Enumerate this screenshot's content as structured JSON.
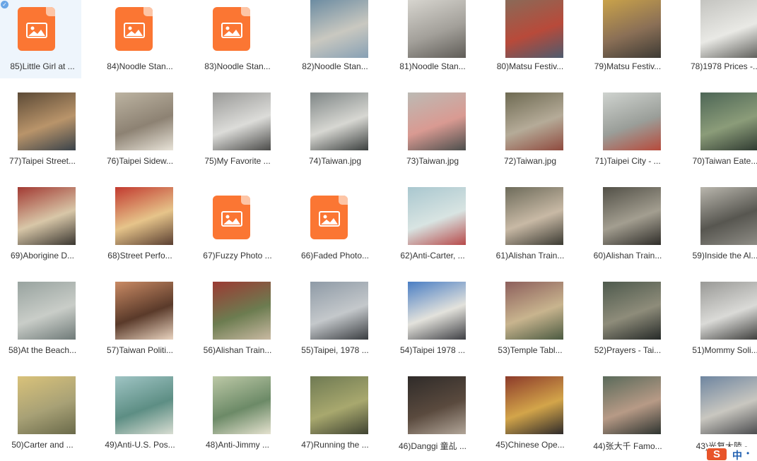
{
  "colors": {
    "selection_bg": "#eef5fc",
    "placeholder_orange": "#fb7633",
    "label_text": "#333333"
  },
  "items": [
    {
      "label": "85)Little Girl at ...",
      "placeholder": true,
      "selected": true,
      "thumb": [
        "#e8e0d6",
        "#c9b7a0",
        "#8a7868"
      ]
    },
    {
      "label": "84)Noodle Stan...",
      "placeholder": true,
      "thumb": [
        "#fff",
        "#fff",
        "#fff"
      ]
    },
    {
      "label": "83)Noodle Stan...",
      "placeholder": true,
      "thumb": [
        "#fff",
        "#fff",
        "#fff"
      ]
    },
    {
      "label": "82)Noodle Stan...",
      "placeholder": false,
      "thumb": [
        "#6c8ca2",
        "#c9c8c0",
        "#87a0b4"
      ]
    },
    {
      "label": "81)Noodle Stan...",
      "placeholder": false,
      "thumb": [
        "#d7d5cf",
        "#a3a09a",
        "#5f5c57"
      ]
    },
    {
      "label": "80)Matsu Festiv...",
      "placeholder": false,
      "thumb": [
        "#8a6a58",
        "#b84a3a",
        "#4d5b6e"
      ]
    },
    {
      "label": "79)Matsu Festiv...",
      "placeholder": false,
      "thumb": [
        "#c9a24a",
        "#8a6f56",
        "#3d3a34"
      ]
    },
    {
      "label": "78)1978 Prices -...",
      "placeholder": false,
      "thumb": [
        "#c4c4c0",
        "#e9e9e5",
        "#5f5f5b"
      ]
    },
    {
      "label": "77)Taipei Street...",
      "placeholder": false,
      "thumb": [
        "#5c4a36",
        "#b9946a",
        "#39424a"
      ]
    },
    {
      "label": "76)Taipei Sidew...",
      "placeholder": false,
      "thumb": [
        "#bcb3a1",
        "#8d8273",
        "#e8e3d8"
      ]
    },
    {
      "label": "75)My Favorite ...",
      "placeholder": false,
      "thumb": [
        "#9a9a98",
        "#dcdcd9",
        "#4b4b49"
      ]
    },
    {
      "label": "74)Taiwan.jpg",
      "placeholder": false,
      "thumb": [
        "#7f8686",
        "#d7d7d2",
        "#3b3f3e"
      ]
    },
    {
      "label": "73)Taiwan.jpg",
      "placeholder": false,
      "thumb": [
        "#bcbab4",
        "#d99a92",
        "#4b4e4c"
      ]
    },
    {
      "label": "72)Taiwan.jpg",
      "placeholder": false,
      "thumb": [
        "#6e6a52",
        "#b5ab98",
        "#8f4a3e"
      ]
    },
    {
      "label": "71)Taipei City - ...",
      "placeholder": false,
      "thumb": [
        "#cfd3cf",
        "#9a9e99",
        "#b74a3b"
      ]
    },
    {
      "label": "70)Taiwan Eate...",
      "placeholder": false,
      "thumb": [
        "#4d6656",
        "#8b9c79",
        "#2f3a31"
      ]
    },
    {
      "label": "69)Aborigine D...",
      "placeholder": false,
      "thumb": [
        "#a23a33",
        "#d8c7a8",
        "#3a3630"
      ]
    },
    {
      "label": "68)Street Perfo...",
      "placeholder": false,
      "thumb": [
        "#c23a2f",
        "#e6c48a",
        "#5a3f31"
      ]
    },
    {
      "label": "67)Fuzzy Photo ...",
      "placeholder": true,
      "thumb": [
        "#fff",
        "#fff",
        "#fff"
      ]
    },
    {
      "label": "66)Faded Photo...",
      "placeholder": true,
      "thumb": [
        "#fff",
        "#fff",
        "#fff"
      ]
    },
    {
      "label": "62)Anti-Carter, ...",
      "placeholder": false,
      "thumb": [
        "#a9c7cf",
        "#d8e4e2",
        "#b74a4a"
      ]
    },
    {
      "label": "61)Alishan Train...",
      "placeholder": false,
      "thumb": [
        "#6d6b5a",
        "#c8b9a5",
        "#3b3a32"
      ]
    },
    {
      "label": "60)Alishan Train...",
      "placeholder": false,
      "thumb": [
        "#525047",
        "#a39e90",
        "#2f2d29"
      ]
    },
    {
      "label": "59)Inside the Al...",
      "placeholder": false,
      "thumb": [
        "#b9b6ad",
        "#575650",
        "#8f8d86"
      ]
    },
    {
      "label": "58)At the Beach...",
      "placeholder": false,
      "thumb": [
        "#98a39f",
        "#c9cdc8",
        "#6f7a78"
      ]
    },
    {
      "label": "57)Taiwan Politi...",
      "placeholder": false,
      "thumb": [
        "#c98a64",
        "#5a3a2a",
        "#e9d3bf"
      ]
    },
    {
      "label": "56)Alishan Train...",
      "placeholder": false,
      "thumb": [
        "#9b3a33",
        "#6c7c50",
        "#c9b9a2"
      ]
    },
    {
      "label": "55)Taipei, 1978 ...",
      "placeholder": false,
      "thumb": [
        "#8e9aa6",
        "#c4c8cb",
        "#3a3d41"
      ]
    },
    {
      "label": "54)Taipei 1978 ...",
      "placeholder": false,
      "thumb": [
        "#4a7ec4",
        "#e3e2dc",
        "#3e3f44"
      ]
    },
    {
      "label": "53)Temple Tabl...",
      "placeholder": false,
      "thumb": [
        "#8d5f5c",
        "#c8b48e",
        "#4b5a41"
      ]
    },
    {
      "label": "52)Prayers - Tai...",
      "placeholder": false,
      "thumb": [
        "#4e5a4d",
        "#8e8c7a",
        "#262a28"
      ]
    },
    {
      "label": "51)Mommy Soli...",
      "placeholder": false,
      "thumb": [
        "#999996",
        "#dadad7",
        "#3e3e3c"
      ]
    },
    {
      "label": "50)Carter and ...",
      "placeholder": false,
      "thumb": [
        "#d9c27a",
        "#a8a176",
        "#6a6a4a"
      ]
    },
    {
      "label": "49)Anti-U.S. Pos...",
      "placeholder": false,
      "thumb": [
        "#9fc4c4",
        "#5d8e84",
        "#d8ddd2"
      ]
    },
    {
      "label": "48)Anti-Jimmy ...",
      "placeholder": false,
      "thumb": [
        "#bcc8a6",
        "#6c8a67",
        "#e5e2cf"
      ]
    },
    {
      "label": "47)Running the ...",
      "placeholder": false,
      "thumb": [
        "#6f7a53",
        "#a8a86e",
        "#3f4331"
      ]
    },
    {
      "label": "46)Danggi 童乩 ...",
      "placeholder": false,
      "thumb": [
        "#2f2b29",
        "#5a4a3e",
        "#b1a598"
      ]
    },
    {
      "label": "45)Chinese Ope...",
      "placeholder": false,
      "thumb": [
        "#8c3a2a",
        "#d3a54a",
        "#2e2a2a"
      ]
    },
    {
      "label": "44)张大千 Famo...",
      "placeholder": false,
      "thumb": [
        "#5a6a5a",
        "#b79a86",
        "#2e3430"
      ]
    },
    {
      "label": "43)光复大陸 -...",
      "placeholder": false,
      "thumb": [
        "#6e85a0",
        "#c9c7c0",
        "#4a4b4e"
      ]
    }
  ],
  "ime": {
    "logo": "S",
    "lang": "中",
    "dot": "•"
  }
}
